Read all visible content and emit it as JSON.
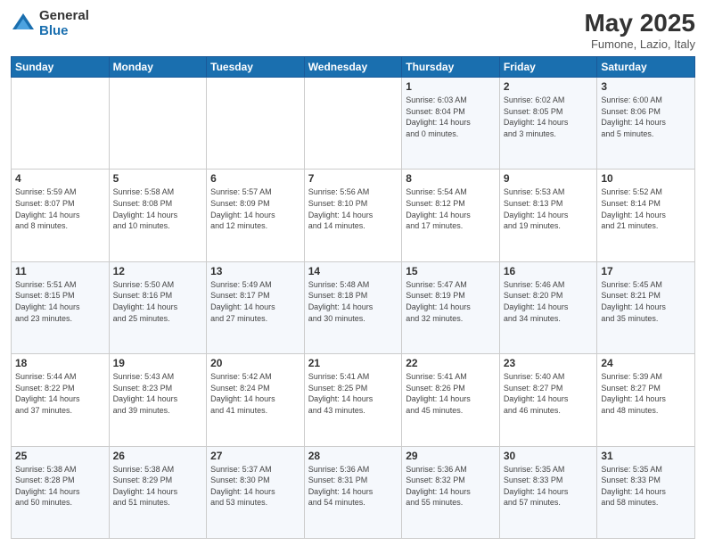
{
  "logo": {
    "general": "General",
    "blue": "Blue"
  },
  "title": "May 2025",
  "location": "Fumone, Lazio, Italy",
  "days_of_week": [
    "Sunday",
    "Monday",
    "Tuesday",
    "Wednesday",
    "Thursday",
    "Friday",
    "Saturday"
  ],
  "weeks": [
    [
      {
        "day": "",
        "info": ""
      },
      {
        "day": "",
        "info": ""
      },
      {
        "day": "",
        "info": ""
      },
      {
        "day": "",
        "info": ""
      },
      {
        "day": "1",
        "info": "Sunrise: 6:03 AM\nSunset: 8:04 PM\nDaylight: 14 hours\nand 0 minutes."
      },
      {
        "day": "2",
        "info": "Sunrise: 6:02 AM\nSunset: 8:05 PM\nDaylight: 14 hours\nand 3 minutes."
      },
      {
        "day": "3",
        "info": "Sunrise: 6:00 AM\nSunset: 8:06 PM\nDaylight: 14 hours\nand 5 minutes."
      }
    ],
    [
      {
        "day": "4",
        "info": "Sunrise: 5:59 AM\nSunset: 8:07 PM\nDaylight: 14 hours\nand 8 minutes."
      },
      {
        "day": "5",
        "info": "Sunrise: 5:58 AM\nSunset: 8:08 PM\nDaylight: 14 hours\nand 10 minutes."
      },
      {
        "day": "6",
        "info": "Sunrise: 5:57 AM\nSunset: 8:09 PM\nDaylight: 14 hours\nand 12 minutes."
      },
      {
        "day": "7",
        "info": "Sunrise: 5:56 AM\nSunset: 8:10 PM\nDaylight: 14 hours\nand 14 minutes."
      },
      {
        "day": "8",
        "info": "Sunrise: 5:54 AM\nSunset: 8:12 PM\nDaylight: 14 hours\nand 17 minutes."
      },
      {
        "day": "9",
        "info": "Sunrise: 5:53 AM\nSunset: 8:13 PM\nDaylight: 14 hours\nand 19 minutes."
      },
      {
        "day": "10",
        "info": "Sunrise: 5:52 AM\nSunset: 8:14 PM\nDaylight: 14 hours\nand 21 minutes."
      }
    ],
    [
      {
        "day": "11",
        "info": "Sunrise: 5:51 AM\nSunset: 8:15 PM\nDaylight: 14 hours\nand 23 minutes."
      },
      {
        "day": "12",
        "info": "Sunrise: 5:50 AM\nSunset: 8:16 PM\nDaylight: 14 hours\nand 25 minutes."
      },
      {
        "day": "13",
        "info": "Sunrise: 5:49 AM\nSunset: 8:17 PM\nDaylight: 14 hours\nand 27 minutes."
      },
      {
        "day": "14",
        "info": "Sunrise: 5:48 AM\nSunset: 8:18 PM\nDaylight: 14 hours\nand 30 minutes."
      },
      {
        "day": "15",
        "info": "Sunrise: 5:47 AM\nSunset: 8:19 PM\nDaylight: 14 hours\nand 32 minutes."
      },
      {
        "day": "16",
        "info": "Sunrise: 5:46 AM\nSunset: 8:20 PM\nDaylight: 14 hours\nand 34 minutes."
      },
      {
        "day": "17",
        "info": "Sunrise: 5:45 AM\nSunset: 8:21 PM\nDaylight: 14 hours\nand 35 minutes."
      }
    ],
    [
      {
        "day": "18",
        "info": "Sunrise: 5:44 AM\nSunset: 8:22 PM\nDaylight: 14 hours\nand 37 minutes."
      },
      {
        "day": "19",
        "info": "Sunrise: 5:43 AM\nSunset: 8:23 PM\nDaylight: 14 hours\nand 39 minutes."
      },
      {
        "day": "20",
        "info": "Sunrise: 5:42 AM\nSunset: 8:24 PM\nDaylight: 14 hours\nand 41 minutes."
      },
      {
        "day": "21",
        "info": "Sunrise: 5:41 AM\nSunset: 8:25 PM\nDaylight: 14 hours\nand 43 minutes."
      },
      {
        "day": "22",
        "info": "Sunrise: 5:41 AM\nSunset: 8:26 PM\nDaylight: 14 hours\nand 45 minutes."
      },
      {
        "day": "23",
        "info": "Sunrise: 5:40 AM\nSunset: 8:27 PM\nDaylight: 14 hours\nand 46 minutes."
      },
      {
        "day": "24",
        "info": "Sunrise: 5:39 AM\nSunset: 8:27 PM\nDaylight: 14 hours\nand 48 minutes."
      }
    ],
    [
      {
        "day": "25",
        "info": "Sunrise: 5:38 AM\nSunset: 8:28 PM\nDaylight: 14 hours\nand 50 minutes."
      },
      {
        "day": "26",
        "info": "Sunrise: 5:38 AM\nSunset: 8:29 PM\nDaylight: 14 hours\nand 51 minutes."
      },
      {
        "day": "27",
        "info": "Sunrise: 5:37 AM\nSunset: 8:30 PM\nDaylight: 14 hours\nand 53 minutes."
      },
      {
        "day": "28",
        "info": "Sunrise: 5:36 AM\nSunset: 8:31 PM\nDaylight: 14 hours\nand 54 minutes."
      },
      {
        "day": "29",
        "info": "Sunrise: 5:36 AM\nSunset: 8:32 PM\nDaylight: 14 hours\nand 55 minutes."
      },
      {
        "day": "30",
        "info": "Sunrise: 5:35 AM\nSunset: 8:33 PM\nDaylight: 14 hours\nand 57 minutes."
      },
      {
        "day": "31",
        "info": "Sunrise: 5:35 AM\nSunset: 8:33 PM\nDaylight: 14 hours\nand 58 minutes."
      }
    ]
  ]
}
